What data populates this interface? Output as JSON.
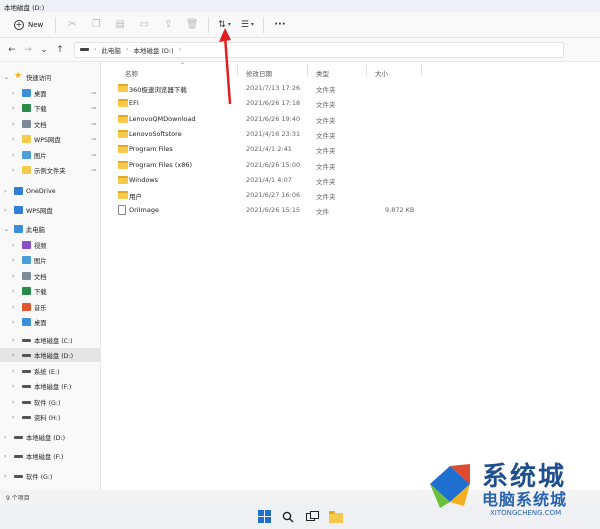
{
  "window": {
    "title": "本地磁盘 (D:)"
  },
  "toolbar": {
    "new_label": "New",
    "icons": [
      "cut-icon",
      "copy-icon",
      "paste-icon",
      "rename-icon",
      "share-icon",
      "delete-icon",
      "sort-icon",
      "view-icon",
      "more-icon"
    ]
  },
  "address": {
    "crumbs": [
      "此电脑",
      "本地磁盘 (D:)"
    ]
  },
  "sidebar": {
    "items": [
      {
        "label": "快速访问",
        "icon": "star-icon",
        "color": "#f2b01e",
        "indent": 0,
        "expanded": true
      },
      {
        "label": "桌面",
        "icon": "desktop-icon",
        "color": "#3b8fd9",
        "indent": 1,
        "pinned": true
      },
      {
        "label": "下载",
        "icon": "download-icon",
        "color": "#2a8a4a",
        "indent": 1,
        "pinned": true
      },
      {
        "label": "文档",
        "icon": "document-icon",
        "color": "#7a8a9a",
        "indent": 1,
        "pinned": true
      },
      {
        "label": "WPS网盘",
        "icon": "cloud-icon",
        "color": "#f6c94a",
        "indent": 1,
        "pinned": true
      },
      {
        "label": "图片",
        "icon": "picture-icon",
        "color": "#4a9fd9",
        "indent": 1,
        "pinned": true
      },
      {
        "label": "示例文件夹",
        "icon": "folder-icon",
        "color": "#f6c94a",
        "indent": 1,
        "pinned": true
      },
      {
        "label": "OneDrive",
        "icon": "onedrive-icon",
        "color": "#2f7fd6",
        "indent": 0
      },
      {
        "label": "WPS网盘",
        "icon": "wps-cloud-icon",
        "color": "#2f7fd6",
        "indent": 0
      },
      {
        "label": "此电脑",
        "icon": "computer-icon",
        "color": "#3b8fd9",
        "indent": 0,
        "expanded": true
      },
      {
        "label": "视频",
        "icon": "video-icon",
        "color": "#8a4fc7",
        "indent": 1
      },
      {
        "label": "图片",
        "icon": "picture-icon",
        "color": "#4a9fd9",
        "indent": 1
      },
      {
        "label": "文档",
        "icon": "document-icon",
        "color": "#7a8a9a",
        "indent": 1
      },
      {
        "label": "下载",
        "icon": "download-icon",
        "color": "#2a8a4a",
        "indent": 1
      },
      {
        "label": "音乐",
        "icon": "music-icon",
        "color": "#e0572e",
        "indent": 1
      },
      {
        "label": "桌面",
        "icon": "desktop-icon",
        "color": "#3b8fd9",
        "indent": 1
      },
      {
        "label": "本地磁盘 (C:)",
        "icon": "drive-icon",
        "color": "#555555",
        "indent": 1
      },
      {
        "label": "本地磁盘 (D:)",
        "icon": "drive-icon",
        "color": "#555555",
        "indent": 1,
        "selected": true
      },
      {
        "label": "系统 (E:)",
        "icon": "drive-icon",
        "color": "#555555",
        "indent": 1
      },
      {
        "label": "本地磁盘 (F:)",
        "icon": "drive-icon",
        "color": "#555555",
        "indent": 1
      },
      {
        "label": "软件 (G:)",
        "icon": "drive-icon",
        "color": "#555555",
        "indent": 1
      },
      {
        "label": "资料 (H:)",
        "icon": "drive-icon",
        "color": "#555555",
        "indent": 1
      },
      {
        "label": "本地磁盘 (D:)",
        "icon": "drive-icon",
        "color": "#555555",
        "indent": 0
      },
      {
        "label": "本地磁盘 (F:)",
        "icon": "drive-icon",
        "color": "#555555",
        "indent": 0
      },
      {
        "label": "软件 (G:)",
        "icon": "drive-icon",
        "color": "#555555",
        "indent": 0
      }
    ]
  },
  "columns": {
    "name": "名称",
    "date": "修改日期",
    "type": "类型",
    "size": "大小"
  },
  "files": [
    {
      "name": "360极速浏览器下载",
      "date": "2021/7/13 17:26",
      "type": "文件夹",
      "size": "",
      "kind": "folder"
    },
    {
      "name": "EFI",
      "date": "2021/6/26 17:18",
      "type": "文件夹",
      "size": "",
      "kind": "folder"
    },
    {
      "name": "LenovoQMDownload",
      "date": "2021/6/26 19:40",
      "type": "文件夹",
      "size": "",
      "kind": "folder"
    },
    {
      "name": "LenovoSoftstore",
      "date": "2021/4/16 23:31",
      "type": "文件夹",
      "size": "",
      "kind": "folder"
    },
    {
      "name": "Program Files",
      "date": "2021/4/1 2:41",
      "type": "文件夹",
      "size": "",
      "kind": "folder"
    },
    {
      "name": "Program Files (x86)",
      "date": "2021/6/26 15:00",
      "type": "文件夹",
      "size": "",
      "kind": "folder"
    },
    {
      "name": "Windows",
      "date": "2021/4/1 4:07",
      "type": "文件夹",
      "size": "",
      "kind": "folder"
    },
    {
      "name": "用户",
      "date": "2021/6/27 16:06",
      "type": "文件夹",
      "size": "",
      "kind": "folder"
    },
    {
      "name": "OriImage",
      "date": "2021/6/26 15:15",
      "type": "文件",
      "size": "9,872 KB",
      "kind": "file"
    }
  ],
  "status": {
    "count": "9 个项目"
  },
  "watermark": {
    "line1": "系统城",
    "line2": "电脑系统城",
    "url": "XITONGCHENG.COM"
  },
  "colors": {
    "folder": "#f6c94a",
    "arrow": "#e02020",
    "selection": "#e5e5e5"
  }
}
